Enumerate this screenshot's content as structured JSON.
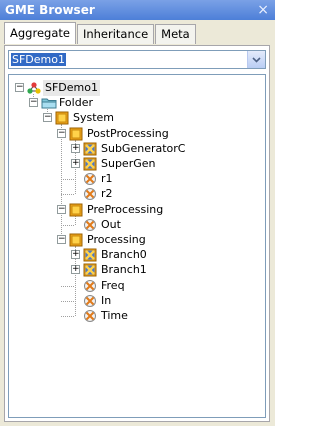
{
  "window": {
    "title": "GME Browser",
    "close": "×"
  },
  "tabs": [
    {
      "label": "Aggregate",
      "active": true
    },
    {
      "label": "Inheritance",
      "active": false
    },
    {
      "label": "Meta",
      "active": false
    }
  ],
  "project_combo": {
    "value": "SFDemo1"
  },
  "tree": {
    "nodes": [
      {
        "label": "SFDemo1",
        "icon": "project-icon",
        "expander": "−"
      },
      {
        "label": "Folder",
        "icon": "folder-icon",
        "expander": "−"
      },
      {
        "label": "System",
        "icon": "model-icon",
        "expander": "−"
      },
      {
        "label": "PostProcessing",
        "icon": "model-icon",
        "expander": "−"
      },
      {
        "label": "SubGeneratorC",
        "icon": "component-icon",
        "expander": "+"
      },
      {
        "label": "SuperGen",
        "icon": "component-icon",
        "expander": "+"
      },
      {
        "label": "r1",
        "icon": "port-icon",
        "expander": ""
      },
      {
        "label": "r2",
        "icon": "port-icon",
        "expander": ""
      },
      {
        "label": "PreProcessing",
        "icon": "model-icon",
        "expander": "−"
      },
      {
        "label": "Out",
        "icon": "port-icon",
        "expander": ""
      },
      {
        "label": "Processing",
        "icon": "model-icon",
        "expander": "−"
      },
      {
        "label": "Branch0",
        "icon": "component-icon",
        "expander": "+"
      },
      {
        "label": "Branch1",
        "icon": "component-icon",
        "expander": "+"
      },
      {
        "label": "Freq",
        "icon": "port-icon",
        "expander": ""
      },
      {
        "label": "In",
        "icon": "port-icon",
        "expander": ""
      },
      {
        "label": "Time",
        "icon": "port-icon",
        "expander": ""
      }
    ]
  },
  "colors": {
    "title_bar": "#5a88dc",
    "selection": "#316ac5",
    "panel": "#ece9d8"
  }
}
